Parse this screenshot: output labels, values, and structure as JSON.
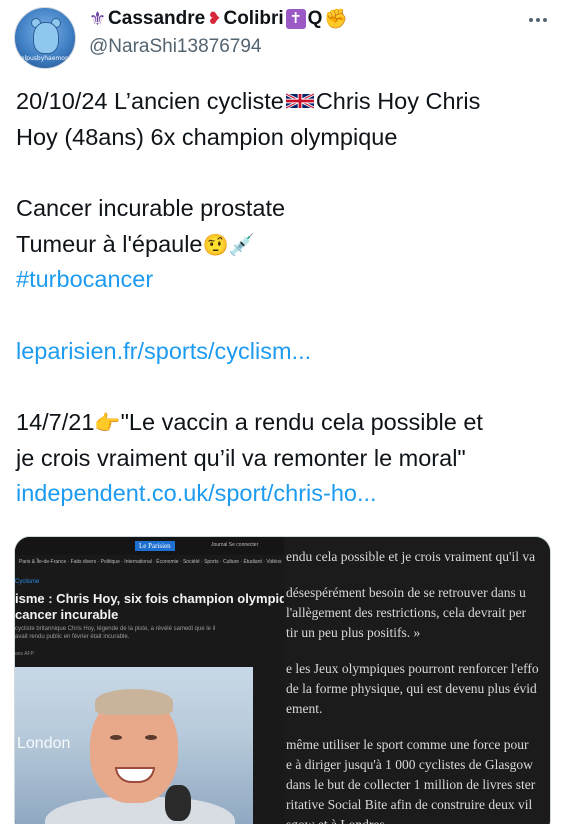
{
  "author": {
    "display_name": "Cassandre",
    "display_name_suffix": "Colibri",
    "display_name_end": "Q",
    "handle": "@NaraShi13876794",
    "avatar_caption": "helpusbyhaemophilia.com",
    "icons": [
      "fleur-de-lis-icon",
      "heart-bird-icon",
      "cross-icon",
      "raised-fist-icon"
    ]
  },
  "more_icon": "more-horizontal-icon",
  "tweet": {
    "line1_pre": "20/10/24 L’ancien cycliste",
    "line1_post": "Chris Hoy Chris",
    "line2": "Hoy (48ans) 6x champion olympique",
    "line3": "Cancer incurable prostate",
    "line4": "Tumeur à l'épaule",
    "line4_emoji": "🤨💉",
    "hashtag": "#turbocancer",
    "link1": "leparisien.fr/sports/cyclism...",
    "line5_pre": "14/7/21",
    "line5_emoji": "👉",
    "line5_post": "\"Le vaccin a rendu cela possible et",
    "line6": "je crois vraiment qu’il va remonter le moral\"",
    "link2": "independent.co.uk/sport/chris-ho..."
  },
  "media": {
    "left": {
      "logo": "Le Parisien",
      "nav": "Paris & Île-de-France · Faits divers · Politique · International · Économie · Société · Sports · Culture · Étudiant · Vidéos",
      "header_right": "Journal   Se connecter",
      "category": "Cyclisme",
      "title_line1": "isme : Chris Hoy, six fois champion olympique, atte",
      "title_line2": "cancer incurable",
      "subtitle": "cycliste britannique Chris Hoy, légende de la piste, a révélé samedi que le il avait rendu public en février était incurable.",
      "byline": "ans AFP",
      "photo_text": "London"
    },
    "right": {
      "lines": [
        "endu cela possible et je crois vraiment qu'il va",
        "",
        "désespérément besoin de se retrouver dans u",
        "l'allègement des restrictions, cela devrait per",
        "tir un peu plus positifs. »",
        "",
        "e les Jeux olympiques pourront renforcer l'effo",
        "de la forme physique, qui est devenu plus évid",
        "ement.",
        "",
        "même utiliser le sport comme une force pour",
        "e à diriger jusqu'à 1 000 cyclistes de Glasgow",
        "dans le but de collecter 1 million de livres ster",
        "ritative Social Bite afin de construire deux vil",
        "sgow et à Londres."
      ]
    }
  }
}
